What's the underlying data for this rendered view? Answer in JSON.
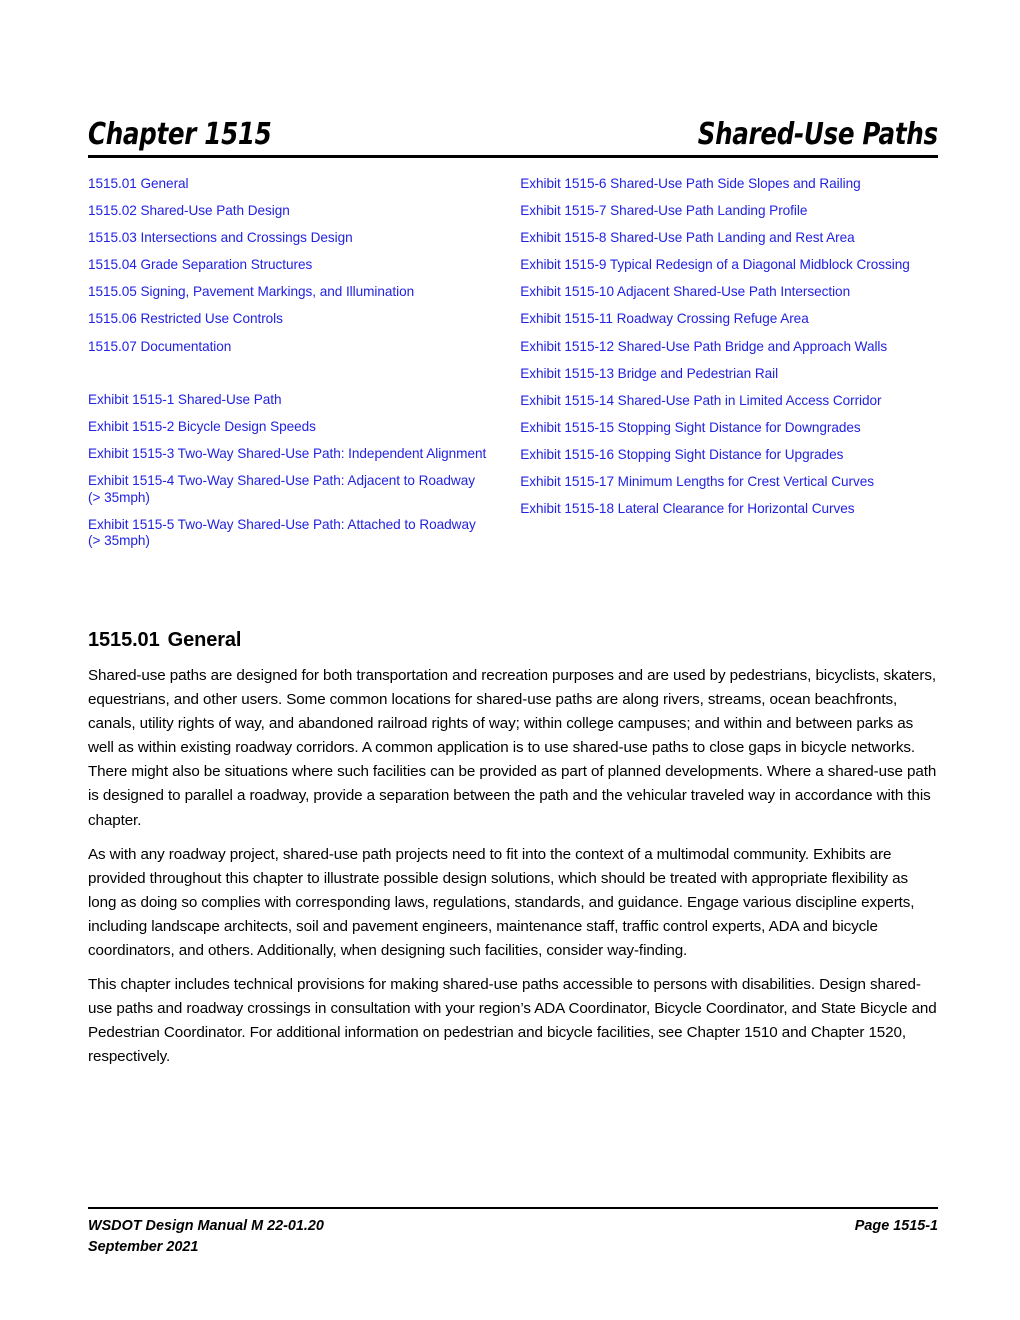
{
  "header": {
    "chapter_label": "Chapter 1515",
    "chapter_title": "Shared-Use Paths"
  },
  "toc": {
    "left_column": {
      "sections": [
        "1515.01 General",
        "1515.02 Shared-Use Path Design",
        "1515.03 Intersections and Crossings Design",
        "1515.04 Grade Separation Structures",
        "1515.05 Signing, Pavement Markings, and Illumination",
        "1515.06 Restricted Use Controls",
        "1515.07 Documentation"
      ],
      "exhibits": [
        "Exhibit 1515-1 Shared-Use Path",
        "Exhibit 1515-2 Bicycle Design Speeds",
        "Exhibit 1515-3 Two-Way Shared-Use Path: Independent Alignment",
        "Exhibit 1515-4 Two-Way Shared-Use Path: Adjacent to Roadway (> 35mph)",
        "Exhibit 1515-5 Two-Way Shared-Use Path: Attached to Roadway (> 35mph)"
      ]
    },
    "right_column": {
      "exhibits": [
        "Exhibit 1515-6 Shared-Use Path Side Slopes and Railing",
        "Exhibit 1515-7 Shared-Use Path Landing Profile",
        "Exhibit 1515-8 Shared-Use Path Landing and Rest Area",
        "Exhibit 1515-9 Typical Redesign of a Diagonal Midblock Crossing",
        "Exhibit 1515-10 Adjacent Shared-Use Path Intersection",
        "Exhibit 1515-11 Roadway Crossing Refuge Area",
        "Exhibit 1515-12 Shared-Use Path Bridge and Approach Walls",
        "Exhibit 1515-13 Bridge and Pedestrian Rail",
        "Exhibit 1515-14 Shared-Use Path in Limited Access Corridor",
        "Exhibit 1515-15 Stopping Sight Distance for Downgrades",
        "Exhibit 1515-16 Stopping Sight Distance for Upgrades",
        "Exhibit 1515-17 Minimum Lengths for Crest Vertical Curves",
        "Exhibit 1515-18 Lateral Clearance for Horizontal Curves"
      ]
    }
  },
  "section": {
    "number": "1515.01",
    "title": "General",
    "paragraphs": [
      "Shared-use paths are designed for both transportation and recreation purposes and are used by pedestrians, bicyclists, skaters, equestrians, and other users. Some common locations for shared-use paths are along rivers, streams, ocean beachfronts, canals, utility rights of way, and abandoned railroad rights of way; within college campuses; and within and between parks as well as within existing roadway corridors. A common application is to use shared-use paths to close gaps in bicycle networks. There might also be situations where such facilities can be provided as part of planned developments. Where a shared-use path is designed to parallel a roadway, provide a separation between the path and the vehicular traveled way in accordance with this chapter.",
      "As with any roadway project, shared-use path projects need to fit into the context of a multimodal community. Exhibits are provided throughout this chapter to illustrate possible design solutions, which should be treated with appropriate flexibility as long as doing so complies with corresponding laws, regulations, standards, and guidance. Engage various discipline experts, including landscape architects, soil and pavement engineers, maintenance staff, traffic control experts, ADA and bicycle coordinators, and others. Additionally, when designing such facilities, consider way-finding.",
      "This chapter includes technical provisions for making shared-use paths accessible to persons with disabilities. Design shared-use paths and roadway crossings in consultation with your region’s ADA Coordinator, Bicycle Coordinator, and State Bicycle and Pedestrian Coordinator. For additional information on pedestrian and bicycle facilities, see Chapter 1510 and Chapter 1520, respectively."
    ]
  },
  "footer": {
    "manual": "WSDOT Design Manual M 22-01.20",
    "date": "September 2021",
    "page": "Page 1515-1"
  },
  "colors": {
    "link_blue": "#2222E2",
    "text_black": "#000000",
    "page_background": "#FFFFFF"
  }
}
